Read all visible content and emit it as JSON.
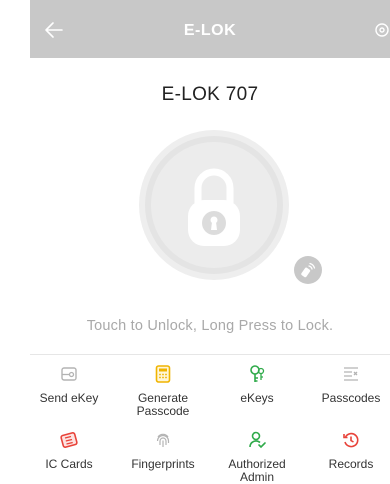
{
  "header": {
    "title": "E-LOK",
    "back_icon": "arrow-left-icon",
    "settings_icon": "settings-icon"
  },
  "lock": {
    "name": "E-LOK 707",
    "icon": "padlock-icon",
    "remote_icon": "remote-unlock-icon"
  },
  "hint": "Touch to Unlock, Long Press to Lock.",
  "menu": [
    {
      "label": "Send eKey",
      "icon": "send-ekey-icon",
      "color": "#b3b3b3"
    },
    {
      "label": "Generate Passcode",
      "icon": "passcode-keypad-icon",
      "color": "#f0b400"
    },
    {
      "label": "eKeys",
      "icon": "ekeys-icon",
      "color": "#2faa4a"
    },
    {
      "label": "Passcodes",
      "icon": "passcodes-list-icon",
      "color": "#b3b3b3"
    },
    {
      "label": "IC Cards",
      "icon": "ic-card-icon",
      "color": "#e8433a"
    },
    {
      "label": "Fingerprints",
      "icon": "fingerprint-icon",
      "color": "#b3b3b3"
    },
    {
      "label": "Authorized Admin",
      "icon": "authorized-admin-icon",
      "color": "#2faa4a"
    },
    {
      "label": "Records",
      "icon": "records-history-icon",
      "color": "#e8433a"
    }
  ],
  "colors": {
    "header_bg": "#c8c8c8",
    "hint_text": "#a9a9a9"
  }
}
